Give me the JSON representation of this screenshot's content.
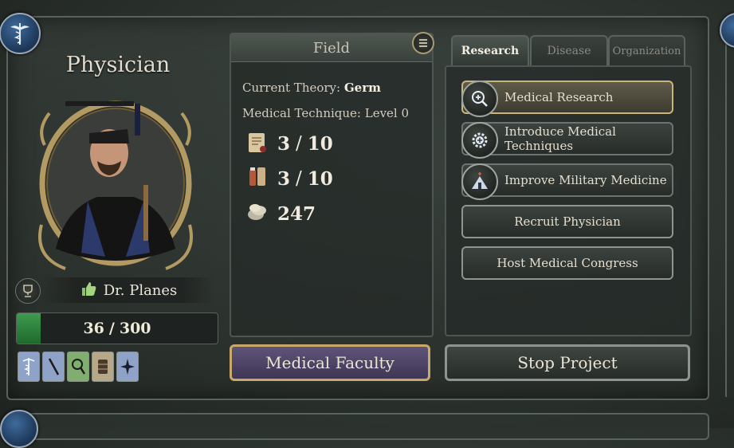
{
  "character": {
    "title": "Physician",
    "name": "Dr. Planes",
    "xp_current": "36",
    "xp_separator": "/",
    "xp_max": "300",
    "xp_fraction": 0.12,
    "traits": [
      "caduceus-trait-icon",
      "scalpel-trait-icon",
      "microscope-trait-icon",
      "lab-trait-icon",
      "sparkle-trait-icon"
    ]
  },
  "field": {
    "header": "Field",
    "theory_label": "Current Theory:",
    "theory_value": "Germ",
    "technique_text": "Medical Technique: Level 0",
    "stats": [
      {
        "icon": "scroll-icon",
        "current": "3",
        "sep": "/",
        "max": "10"
      },
      {
        "icon": "vials-icon",
        "current": "3",
        "sep": "/",
        "max": "10"
      },
      {
        "icon": "coins-icon",
        "current": "247"
      }
    ]
  },
  "tabs": [
    "Research",
    "Disease",
    "Organization"
  ],
  "actions": [
    {
      "label": "Medical Research",
      "icon": "magnifier-plus-icon"
    },
    {
      "label": "Introduce Medical Techniques",
      "icon": "gear-plus-icon"
    },
    {
      "label": "Improve Military Medicine",
      "icon": "field-hospital-icon"
    },
    {
      "label": "Recruit Physician"
    },
    {
      "label": "Host Medical Congress"
    }
  ],
  "buttons": {
    "faculty": "Medical Faculty",
    "stop": "Stop Project"
  },
  "colors": {
    "xp_fill": "#3e9b4e",
    "faculty_bg": "#5e5478",
    "gold_border": "#c9a869"
  }
}
